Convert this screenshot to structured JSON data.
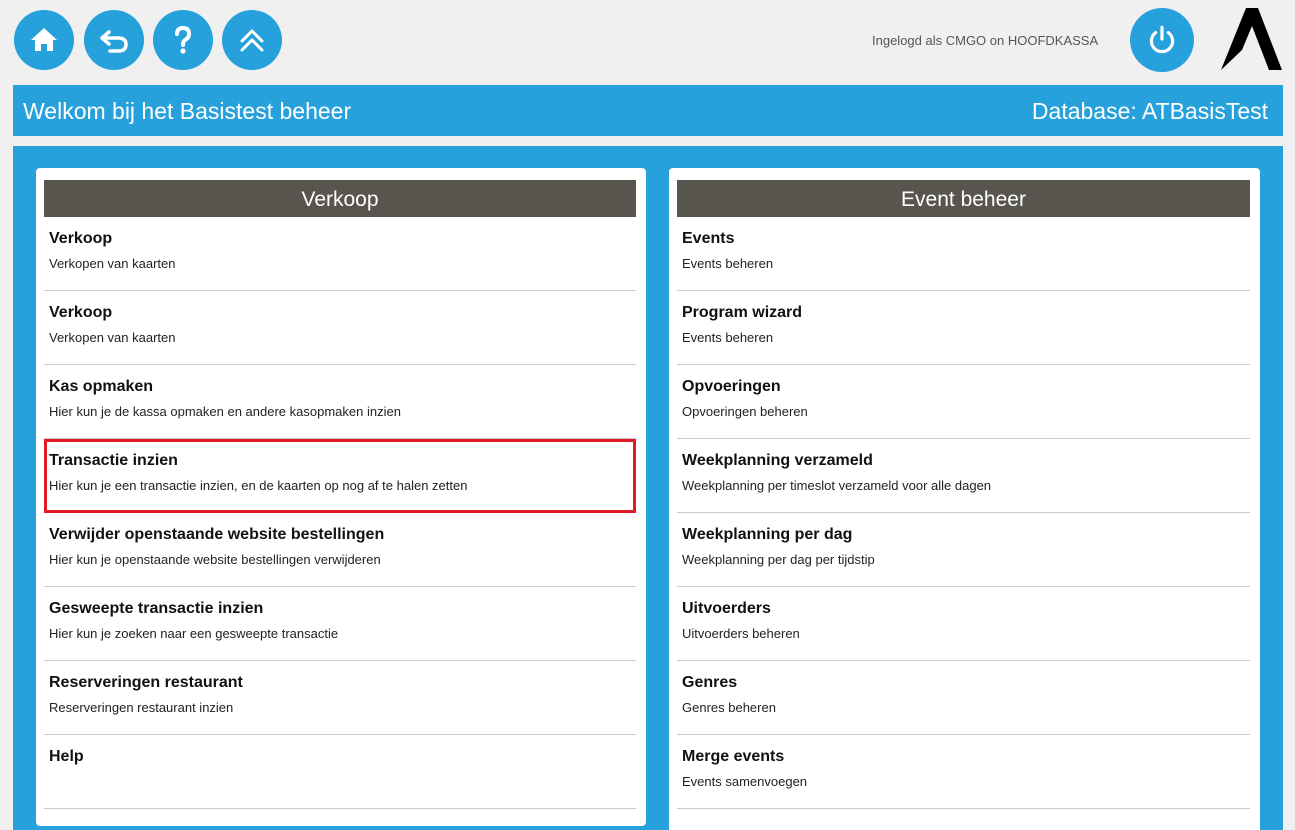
{
  "topbar": {
    "nav": [
      {
        "icon": "home-icon"
      },
      {
        "icon": "back-icon"
      },
      {
        "icon": "help-icon"
      },
      {
        "icon": "collapse-up-icon"
      }
    ],
    "login_text": "Ingelogd als CMGO on HOOFDKASSA",
    "power_icon": "power-icon",
    "logo_icon": "brand-logo-icon"
  },
  "header": {
    "title": "Welkom bij het Basistest beheer",
    "database": "Database: ATBasisTest"
  },
  "colors": {
    "accent": "#27a1dc",
    "panel_header": "#58554f",
    "highlight": "#e31b23"
  },
  "verkoop": {
    "title": "Verkoop",
    "items": [
      {
        "title": "Verkoop",
        "desc": "Verkopen van kaarten"
      },
      {
        "title": "Verkoop",
        "desc": "Verkopen van kaarten"
      },
      {
        "title": "Kas opmaken",
        "desc": "Hier kun je de kassa opmaken en andere kasopmaken inzien"
      },
      {
        "title": "Transactie inzien",
        "desc": "Hier kun je een transactie inzien, en de kaarten op nog af te halen zetten"
      },
      {
        "title": "Verwijder openstaande website bestellingen",
        "desc": "Hier kun je openstaande website bestellingen verwijderen"
      },
      {
        "title": "Gesweepte transactie inzien",
        "desc": "Hier kun je zoeken naar een gesweepte transactie"
      },
      {
        "title": "Reserveringen restaurant",
        "desc": "Reserveringen restaurant inzien"
      },
      {
        "title": "Help",
        "desc": ""
      }
    ]
  },
  "event_beheer": {
    "title": "Event beheer",
    "items": [
      {
        "title": "Events",
        "desc": "Events beheren"
      },
      {
        "title": "Program wizard",
        "desc": "Events beheren"
      },
      {
        "title": "Opvoeringen",
        "desc": "Opvoeringen beheren"
      },
      {
        "title": "Weekplanning verzameld",
        "desc": "Weekplanning per timeslot verzameld voor alle dagen"
      },
      {
        "title": "Weekplanning per dag",
        "desc": "Weekplanning per dag per tijdstip"
      },
      {
        "title": "Uitvoerders",
        "desc": "Uitvoerders beheren"
      },
      {
        "title": "Genres",
        "desc": "Genres beheren"
      },
      {
        "title": "Merge events",
        "desc": "Events samenvoegen"
      }
    ]
  }
}
